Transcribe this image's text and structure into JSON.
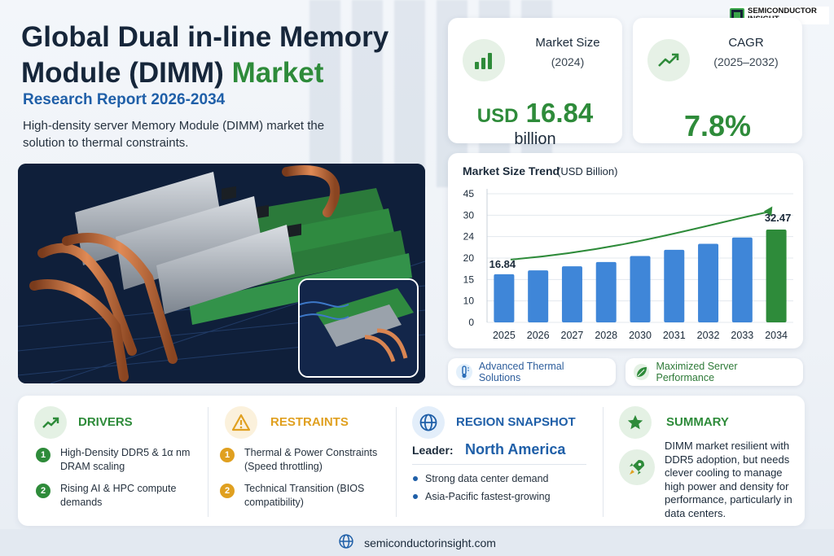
{
  "brand": {
    "logo_text_1": "SEMICONDUCTOR",
    "logo_text_2": "INSIGHT"
  },
  "header": {
    "title_main": "Global Dual in-line Memory Module (DIMM)",
    "title_accent": "Market",
    "subtitle": "Research Report 2026-2034",
    "description": "High-density server Memory Module (DIMM) market the solution to thermal constraints."
  },
  "market_size": {
    "label": "Market Size",
    "period": "(2024)",
    "currency": "USD",
    "value": "16.84",
    "unit": "billion",
    "icon": "bar-chart-icon"
  },
  "cagr": {
    "label": "CAGR",
    "period": "(2025–2032)",
    "value": "7.8%",
    "icon": "trend-up-icon"
  },
  "chart_data": {
    "type": "bar",
    "title": "Market Size Trend",
    "unit_label": "(USD Billion)",
    "categories": [
      "2025",
      "2026",
      "2027",
      "2028",
      "2030",
      "2031",
      "2032",
      "2033",
      "2034"
    ],
    "values": [
      16.84,
      18.2,
      19.6,
      21.1,
      23.2,
      25.4,
      27.5,
      29.7,
      32.47
    ],
    "ylim": [
      0,
      45
    ],
    "yticks": [
      "0",
      "10",
      "15",
      "20",
      "24",
      "30",
      "45"
    ],
    "data_labels": {
      "first": "16.84",
      "last": "32.47"
    },
    "colors": {
      "bar": "#3f86d8",
      "bar_last": "#2e8b3a",
      "trend": "#2e8b3a"
    }
  },
  "features": [
    {
      "label": "Advanced Thermal Solutions",
      "icon": "thermometer-icon"
    },
    {
      "label": "Maximized Server Performance",
      "icon": "leaf-icon"
    }
  ],
  "drivers": {
    "title": "DRIVERS",
    "items": [
      {
        "num": "1",
        "text": "High-Density DDR5 & 1α nm DRAM scaling"
      },
      {
        "num": "2",
        "text": "Rising AI & HPC compute demands"
      }
    ]
  },
  "restraints": {
    "title": "RESTRAINTS",
    "items": [
      {
        "num": "1",
        "text": "Thermal & Power Constraints (Speed throttling)"
      },
      {
        "num": "2",
        "text": "Technical Transition (BIOS compatibility)"
      }
    ]
  },
  "region": {
    "title": "REGION SNAPSHOT",
    "leader_label": "Leader:",
    "leader_value": "North America",
    "bullets": [
      "Strong data center demand",
      "Asia-Pacific fastest-growing"
    ]
  },
  "summary": {
    "title": "SUMMARY",
    "text": "DIMM market resilient with DDR5 adoption, but needs clever cooling to manage high power and density for performance, particularly in data centers."
  },
  "footer": {
    "url": "semiconductorinsight.com"
  },
  "colors": {
    "green": "#2e8b3a",
    "blue": "#1f5fa8",
    "orange": "#e0a020"
  }
}
